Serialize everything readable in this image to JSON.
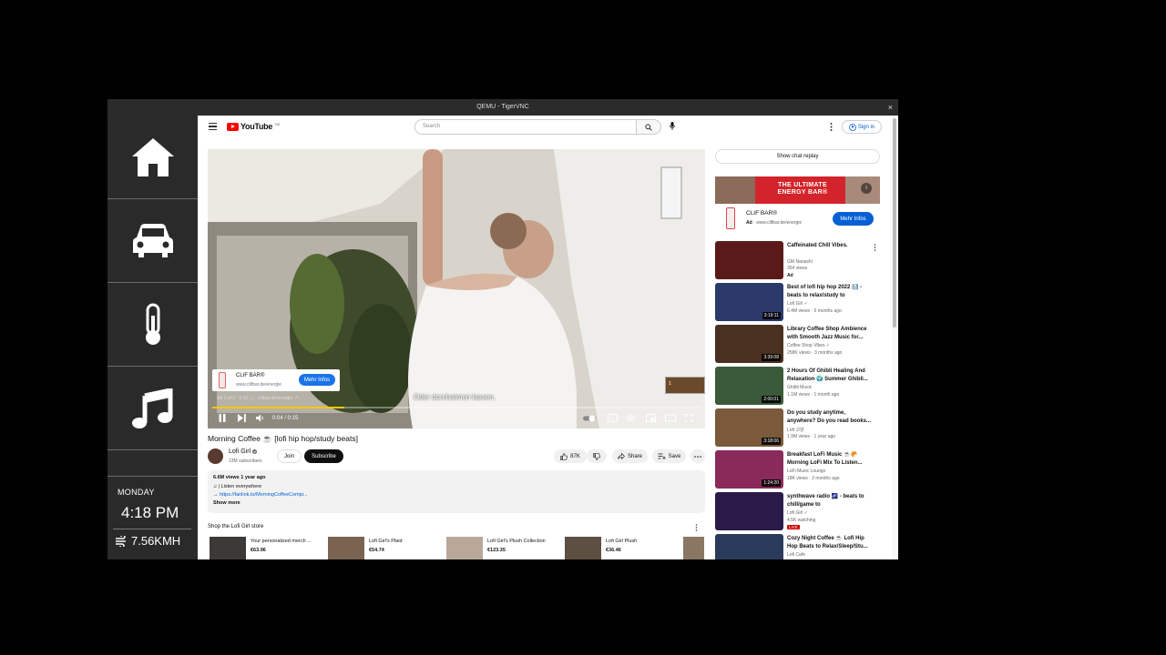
{
  "window": {
    "title": "QEMU - TigerVNC",
    "close": "×"
  },
  "dashboard": {
    "buttons": [
      "home-icon",
      "car-icon",
      "thermometer-icon",
      "music-icon"
    ],
    "day": "MONDAY",
    "time": "4:18 PM",
    "speed": "7.56KMH"
  },
  "header": {
    "logo": "YouTube",
    "region": "DE",
    "search_placeholder": "Search",
    "signin": "Sign in"
  },
  "player": {
    "ad_name": "CLIF BAR®",
    "ad_url": "www.clifbar.de/energie",
    "ad_button": "Mehr Infos",
    "ad_meta": "Ad 1 of 2 · 0:10  ⓘ · clifbar.de/energie ↗",
    "subtitle": "Oder durchatmen lassen.",
    "next_ad": "1",
    "time": "0:04 / 0:15",
    "progress": 0.27
  },
  "video": {
    "title": "Morning Coffee ☕ [lofi hip hop/study beats]",
    "channel": "Lofi Girl",
    "subscribers": "13M subscribers",
    "join": "Join",
    "subscribe": "Subscribe",
    "likes": "87K",
    "share": "Share",
    "save": "Save"
  },
  "description": {
    "stats": "6.6M views  1 year ago",
    "line1": "♫ | Listen everywhere",
    "line2_prefix": "→ ",
    "line2_link": "https://fanlink.to/MorningCoffeeCompi...",
    "show_more": "Show more"
  },
  "shop": {
    "title": "Shop the Lofi Girl store",
    "items": [
      {
        "name": "Your personalized merch ...",
        "price": "€63.96"
      },
      {
        "name": "Lofi Girl's Plaid",
        "price": "€54.74"
      },
      {
        "name": "Lofi Girl's Plush Collection",
        "price": "€123.35"
      },
      {
        "name": "Lofi Girl Plush",
        "price": "€36.46"
      }
    ]
  },
  "sidebar": {
    "chat_replay": "Show chat replay",
    "ad_banner_text": "THE ULTIMATE ENERGY BAR®",
    "ad_name": "CLIF BAR®",
    "ad_label": "Ad",
    "ad_url": "· www.clifbar.de/energie",
    "ad_button": "Mehr Infos",
    "recommendations": [
      {
        "title": "Caffeinated Chill Vibes.",
        "channel": "GM Nanashi",
        "views": "354 views",
        "extra": "Ad",
        "duration": "",
        "thumb": "#5a1a1a"
      },
      {
        "title": "Best of lofi hip hop 2022 🔝 - beats to relax/study to",
        "channel": "Lofi Girl ✓",
        "views": "6.4M views · 6 months ago",
        "extra": "",
        "duration": "3:19:11",
        "thumb": "#2b3a6b"
      },
      {
        "title": "Library Coffee Shop Ambience with Smooth Jazz Music for...",
        "channel": "Coffee Shop Vibes ✓",
        "views": "258K views · 3 months ago",
        "extra": "",
        "duration": "3:39:08",
        "thumb": "#4a3020"
      },
      {
        "title": "2 Hours Of Ghibli Healing And Relaxation 🌍 Summer Ghibli...",
        "channel": "Ghibli Music",
        "views": "1.1M views · 1 month ago",
        "extra": "",
        "duration": "2:00:01",
        "thumb": "#3a5a3a"
      },
      {
        "title": "Do you study anytime, anywhere? Do you read books...",
        "channel": "Lofi 고양",
        "views": "1.9M views · 1 year ago",
        "extra": "",
        "duration": "3:18:06",
        "thumb": "#7a5a3a"
      },
      {
        "title": "Breakfast LoFi Music ☕🥐 Morning LoFi Mix To Listen...",
        "channel": "LoFi Music Lounge",
        "views": "18K views · 2 months ago",
        "extra": "",
        "duration": "1:24:20",
        "thumb": "#8a2a5a"
      },
      {
        "title": "synthwave radio 🌌 - beats to chill/game to",
        "channel": "Lofi Girl ✓",
        "views": "4.5K watching",
        "extra": "LIVE",
        "duration": "",
        "thumb": "#2a1a4a"
      },
      {
        "title": "Cozy Night Coffee ☕ Lofi Hip Hop Beats to Relax/Sleep/Stu...",
        "channel": "Lofi Cafe",
        "views": "",
        "extra": "",
        "duration": "",
        "thumb": "#2a3a5a"
      }
    ]
  },
  "colors": {
    "accent": "#065fd4",
    "brand_red": "#ff0000",
    "ad_red": "#d3242b",
    "dash_bg": "#2a2a2a"
  }
}
